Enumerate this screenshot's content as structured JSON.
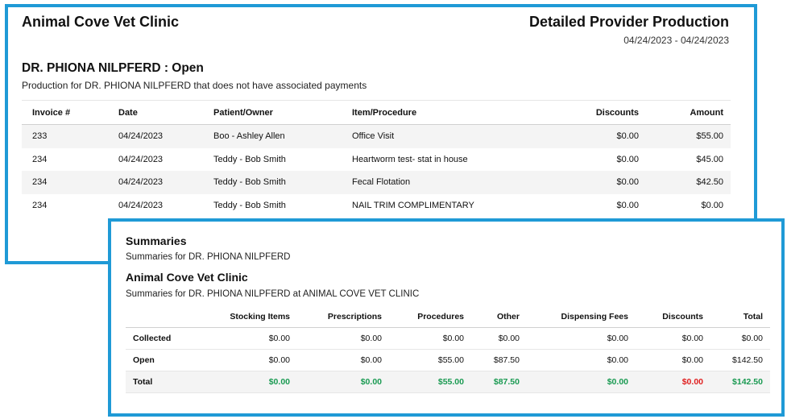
{
  "report": {
    "clinic_name": "Animal Cove Vet Clinic",
    "title": "Detailed Provider Production",
    "date_range": "04/24/2023 - 04/24/2023",
    "provider_heading": "DR. PHIONA NILPFERD : Open",
    "provider_subtitle": "Production for DR. PHIONA NILPFERD that does not have associated payments",
    "columns": [
      "Invoice #",
      "Date",
      "Patient/Owner",
      "Item/Procedure",
      "Discounts",
      "Amount"
    ],
    "rows": [
      {
        "invoice": "233",
        "date": "04/24/2023",
        "patient": "Boo - Ashley Allen",
        "item": "Office Visit",
        "discounts": "$0.00",
        "amount": "$55.00"
      },
      {
        "invoice": "234",
        "date": "04/24/2023",
        "patient": "Teddy - Bob Smith",
        "item": "Heartworm test- stat in house",
        "discounts": "$0.00",
        "amount": "$45.00"
      },
      {
        "invoice": "234",
        "date": "04/24/2023",
        "patient": "Teddy - Bob Smith",
        "item": "Fecal Flotation",
        "discounts": "$0.00",
        "amount": "$42.50"
      },
      {
        "invoice": "234",
        "date": "04/24/2023",
        "patient": "Teddy - Bob Smith",
        "item": "NAIL TRIM COMPLIMENTARY",
        "discounts": "$0.00",
        "amount": "$0.00"
      }
    ]
  },
  "summaries": {
    "title": "Summaries",
    "subtitle": "Summaries for DR. PHIONA NILPFERD",
    "clinic_title": "Animal Cove Vet Clinic",
    "clinic_subtitle": "Summaries for DR. PHIONA NILPFERD at ANIMAL COVE VET CLINIC",
    "columns": [
      "",
      "Stocking Items",
      "Prescriptions",
      "Procedures",
      "Other",
      "Dispensing Fees",
      "Discounts",
      "Total"
    ],
    "rows": [
      {
        "label": "Collected",
        "values": [
          "$0.00",
          "$0.00",
          "$0.00",
          "$0.00",
          "$0.00",
          "$0.00",
          "$0.00"
        ]
      },
      {
        "label": "Open",
        "values": [
          "$0.00",
          "$0.00",
          "$55.00",
          "$87.50",
          "$0.00",
          "$0.00",
          "$142.50"
        ]
      },
      {
        "label": "Total",
        "values": [
          "$0.00",
          "$0.00",
          "$55.00",
          "$87.50",
          "$0.00",
          "$0.00",
          "$142.50"
        ]
      }
    ]
  },
  "colors": {
    "panel_border": "#1f9ad6",
    "total_positive": "#1a9a52",
    "total_discount": "#e01e1e"
  }
}
